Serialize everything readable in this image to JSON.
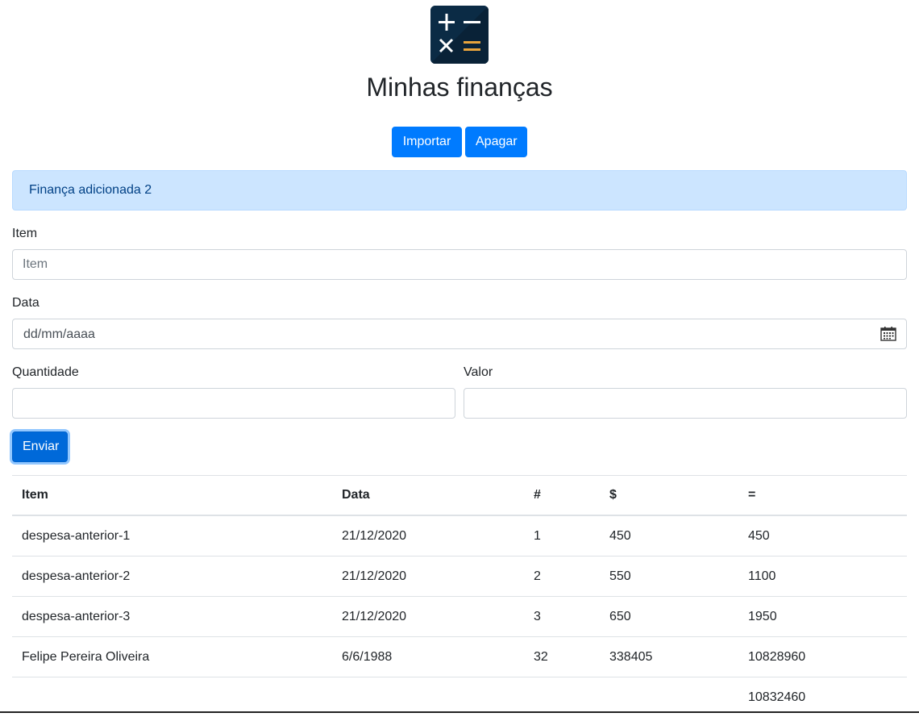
{
  "header": {
    "title": "Minhas finanças",
    "logo_icon": "calculator-icon"
  },
  "actions": {
    "import_label": "Importar",
    "delete_label": "Apagar"
  },
  "alert": {
    "message": "Finança adicionada 2",
    "color": "#cce5ff"
  },
  "form": {
    "item_label": "Item",
    "item_placeholder": "Item",
    "item_value": "",
    "date_label": "Data",
    "date_placeholder": "dd/mm/aaaa",
    "quantity_label": "Quantidade",
    "quantity_value": "",
    "value_label": "Valor",
    "value_value": "",
    "submit_label": "Enviar"
  },
  "table": {
    "headers": [
      "Item",
      "Data",
      "#",
      "$",
      "="
    ],
    "rows": [
      [
        "despesa-anterior-1",
        "21/12/2020",
        "1",
        "450",
        "450"
      ],
      [
        "despesa-anterior-2",
        "21/12/2020",
        "2",
        "550",
        "1100"
      ],
      [
        "despesa-anterior-3",
        "21/12/2020",
        "3",
        "650",
        "1950"
      ],
      [
        "Felipe Pereira Oliveira",
        "6/6/1988",
        "32",
        "338405",
        "10828960"
      ]
    ],
    "total": "10832460"
  },
  "colors": {
    "primary": "#007bff",
    "logo_bg": "#0b2b45",
    "logo_accent": "#e8a43c"
  }
}
